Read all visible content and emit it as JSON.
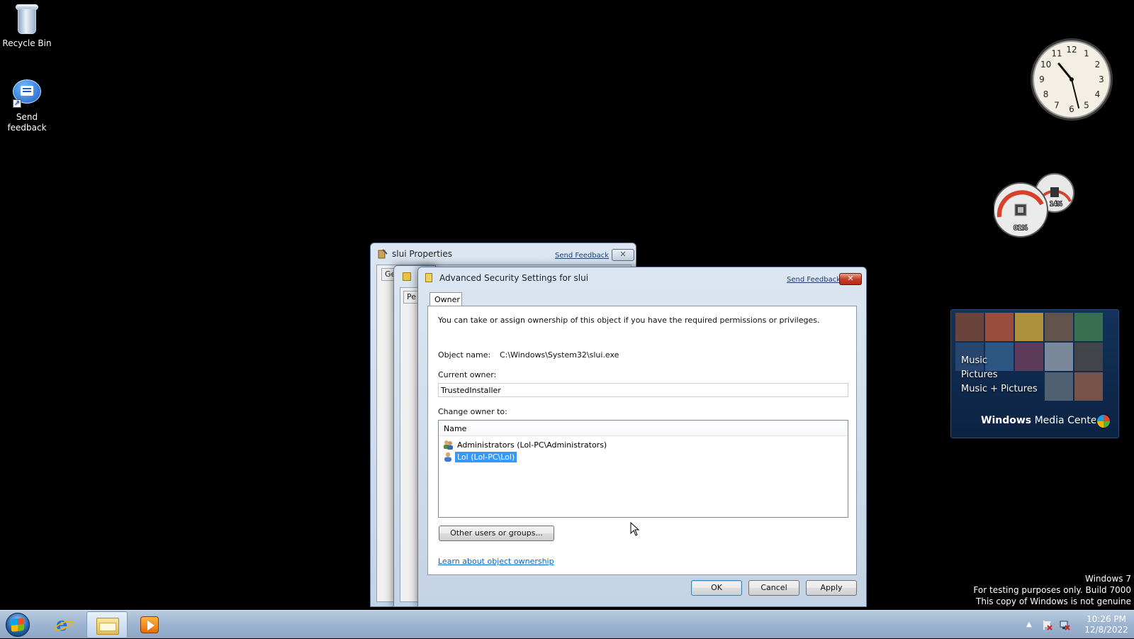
{
  "desktop": {
    "icons": [
      {
        "label": "Recycle Bin"
      },
      {
        "label": "Send feedback"
      }
    ]
  },
  "gadgets": {
    "clock": {
      "time_shown": "10:26",
      "dial": [
        "12",
        "1",
        "2",
        "3",
        "4",
        "5",
        "6",
        "7",
        "8",
        "9",
        "10",
        "11"
      ]
    },
    "cpu_meter": {
      "cpu": "01%",
      "memory": "14%"
    },
    "media_center": {
      "menu": [
        "Music",
        "Pictures",
        "Music + Pictures"
      ],
      "brand_bold": "Windows",
      "brand_rest": "Media Center"
    }
  },
  "background_windows": {
    "slui_properties": {
      "title": "slui Properties",
      "send_feedback": "Send Feedback",
      "tab_partial": "Ge"
    },
    "permissions_dialog": {
      "tab_partial": "Pe"
    }
  },
  "dialog": {
    "title": "Advanced Security Settings for slui",
    "send_feedback": "Send Feedback",
    "tab": "Owner",
    "intro": "You can take or assign ownership of this object if you have the required permissions or privileges.",
    "object_name_label": "Object name:",
    "object_name_value": "C:\\Windows\\System32\\slui.exe",
    "current_owner_label": "Current owner:",
    "current_owner_value": "TrustedInstaller",
    "change_owner_label": "Change owner to:",
    "list_header": "Name",
    "owners": [
      {
        "name": "Administrators (Lol-PC\\Administrators)",
        "selected": false,
        "icon": "group-icon"
      },
      {
        "name": "Lol (Lol-PC\\Lol)",
        "selected": true,
        "icon": "user-icon"
      }
    ],
    "other_users_button": "Other users or groups...",
    "learn_link": "Learn about object ownership",
    "ok": "OK",
    "cancel": "Cancel",
    "apply": "Apply"
  },
  "watermark": {
    "line1": "Windows 7",
    "line2": "For testing purposes only. Build 7000",
    "line3": "This copy of Windows is not genuine"
  },
  "taskbar": {
    "clock_time": "10:26 PM",
    "clock_date": "12/8/2022",
    "tray_arrow": "▲"
  }
}
